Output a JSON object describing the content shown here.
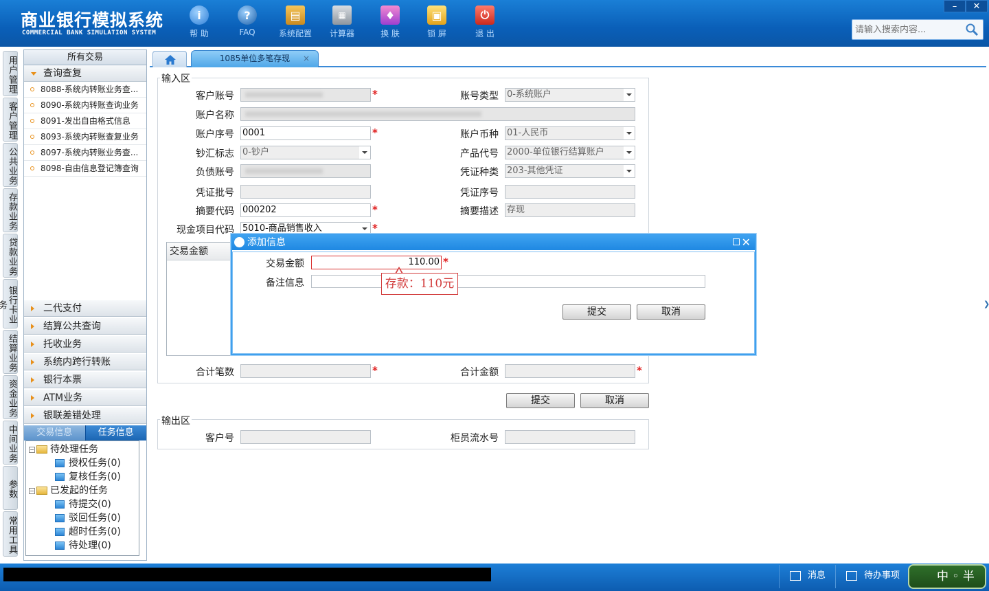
{
  "header": {
    "title_cn": "商业银行模拟系统",
    "title_en": "COMMERCIAL BANK SIMULATION SYSTEM",
    "tools": [
      {
        "icon": "info-icon",
        "label": "帮 助"
      },
      {
        "icon": "faq-icon",
        "label": "FAQ"
      },
      {
        "icon": "config-icon",
        "label": "系统配置"
      },
      {
        "icon": "calculator-icon",
        "label": "计算器"
      },
      {
        "icon": "skin-icon",
        "label": "换 肤"
      },
      {
        "icon": "lock-icon",
        "label": "锁 屏"
      },
      {
        "icon": "power-icon",
        "label": "退 出"
      }
    ],
    "window_buttons": {
      "minimize": "–",
      "close": "✕"
    },
    "search_placeholder": "请输入搜索内容..."
  },
  "vtabs": [
    "用户管理",
    "客户管理",
    "公共业务",
    "存款业务",
    "贷款业务",
    "银行卡业务",
    "结算业务",
    "资金业务",
    "中间业务",
    "参数",
    "常用工具"
  ],
  "left_panel": {
    "header": "所有交易",
    "open_group": "查询查复",
    "items": [
      "8088-系统内转账业务查...",
      "8090-系统内转账查询业务",
      "8091-发出自由格式信息",
      "8093-系统内转账查复业务",
      "8097-系统内转账业务查...",
      "8098-自由信息登记簿查询"
    ],
    "groups": [
      "二代支付",
      "结算公共查询",
      "托收业务",
      "系统内跨行转账",
      "银行本票",
      "ATM业务",
      "银联差错处理"
    ],
    "tabs": {
      "tab1": "交易信息",
      "tab2": "任务信息"
    },
    "tree": {
      "pending": "待处理任务",
      "pending_children": [
        "授权任务(0)",
        "复核任务(0)"
      ],
      "initiated": "已发起的任务",
      "initiated_children": [
        "待提交(0)",
        "驳回任务(0)",
        "超时任务(0)",
        "待处理(0)"
      ]
    }
  },
  "main_tabs": {
    "active": "1085单位多笔存现"
  },
  "input_area": {
    "title": "输入区",
    "labels": {
      "cust_account": "客户账号",
      "account_type": "账号类型",
      "account_name": "账户名称",
      "account_seq": "账户序号",
      "currency": "账户币种",
      "cash_flag": "钞汇标志",
      "product_code": "产品代号",
      "liability_acct": "负债账号",
      "voucher_type": "凭证种类",
      "voucher_batch": "凭证批号",
      "voucher_seq": "凭证序号",
      "summary_code": "摘要代码",
      "summary_desc": "摘要描述",
      "cash_item": "现金项目代码",
      "txn_amount": "交易金额",
      "total_count": "合计笔数",
      "total_amount": "合计金额"
    },
    "values": {
      "account_type": "0-系统账户",
      "account_seq": "0001",
      "currency": "01-人民币",
      "cash_flag": "0-钞户",
      "product_code": "2000-单位银行结算账户",
      "voucher_type": "203-其他凭证",
      "summary_code": "000202",
      "summary_desc": "存现",
      "cash_item": "5010-商品销售收入"
    },
    "buttons": {
      "submit": "提交",
      "cancel": "取消"
    }
  },
  "output_area": {
    "title": "输出区",
    "labels": {
      "cust_no": "客户号",
      "teller_serial": "柜员流水号"
    }
  },
  "dialog": {
    "title": "添加信息",
    "amount_label": "交易金额",
    "amount_value": "110.00",
    "remark_label": "备注信息",
    "tooltip": "存款：110元",
    "buttons": {
      "submit": "提交",
      "cancel": "取消"
    }
  },
  "status_bar": {
    "message": "消息",
    "todo": "待办事项",
    "ime": "中 ◦ 半 简"
  },
  "colors": {
    "header_blue": "#0a5fb8",
    "accent_blue": "#3fa0ee",
    "required_red": "#e02020",
    "tooltip_red": "#d23b3b"
  }
}
